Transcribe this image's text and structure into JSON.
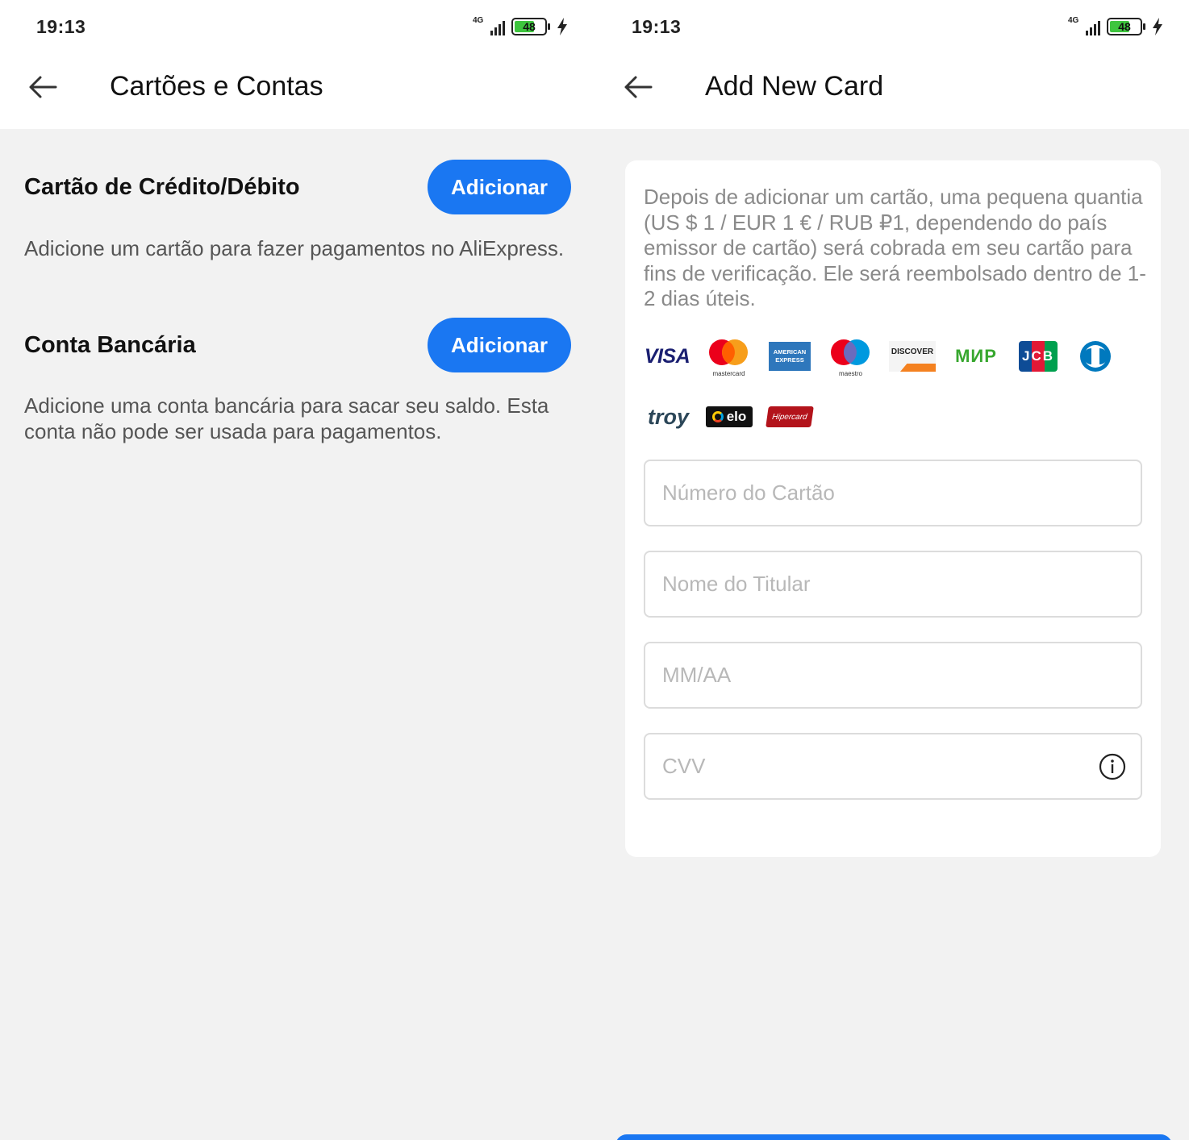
{
  "left": {
    "status": {
      "time": "19:13",
      "network": "4G",
      "battery": "48"
    },
    "header": {
      "title": "Cartões e Contas"
    },
    "sections": [
      {
        "title": "Cartão de Crédito/Débito",
        "button_label": "Adicionar",
        "description": "Adicione um cartão para fazer pagamentos no AliExpress."
      },
      {
        "title": "Conta Bancária",
        "button_label": "Adicionar",
        "description": "Adicione uma conta bancária para sacar seu saldo. Esta conta não pode ser usada para pagamentos."
      }
    ]
  },
  "right": {
    "status": {
      "time": "19:13",
      "network": "4G",
      "battery": "48"
    },
    "header": {
      "title": "Add New Card"
    },
    "notice": "Depois de adicionar um cartão, uma pequena quantia (US $ 1 / EUR 1 € / RUB ₽1, dependendo do país emissor de cartão) será cobrada em seu cartão para fins de verificação. Ele será reembolsado dentro de 1-2 dias úteis.",
    "card_brands": {
      "visa": "VISA",
      "mastercard": "mastercard",
      "amex_line1": "AMERICAN",
      "amex_line2": "EXPRESS",
      "maestro": "maestro",
      "discover": "DISCOVER",
      "mir": "МИР",
      "jcb": "JCB",
      "troy": "troy",
      "elo": "elo",
      "hipercard": "Hipercard"
    },
    "fields": {
      "card_number_placeholder": "Número do Cartão",
      "holder_name_placeholder": "Nome do Titular",
      "expiry_placeholder": "MM/AA",
      "cvv_placeholder": "CVV"
    }
  },
  "colors": {
    "accent": "#1a77f2",
    "background": "#f2f2f2",
    "battery_fill": "#3ec53e"
  }
}
